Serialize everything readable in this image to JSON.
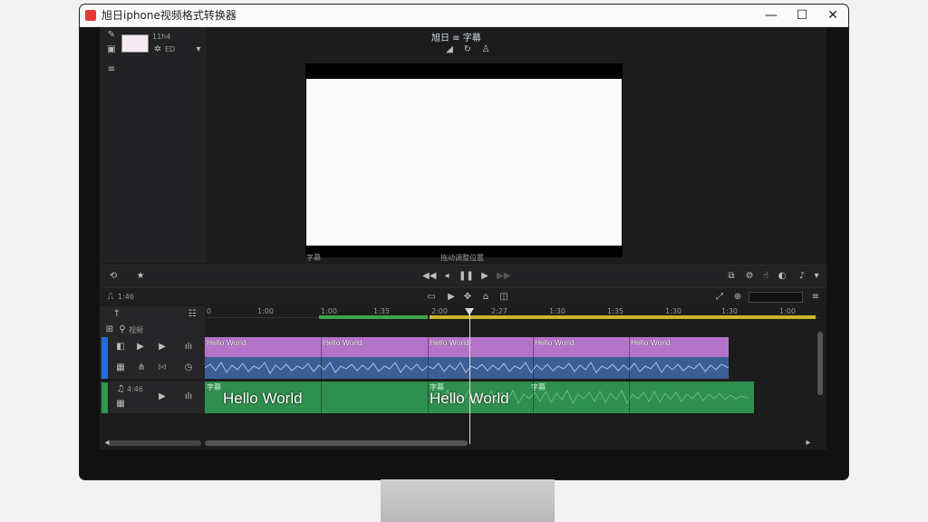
{
  "window": {
    "title": "旭日iphone视频格式转换器",
    "minimize": "—",
    "maximize": "☐",
    "close": "✕"
  },
  "top_panel": {
    "thumb_label": "11h4",
    "small_btn": "ED",
    "center_title": "旭日 ≡ 字幕",
    "under_video_left": "字幕",
    "under_video_center": "拖动调整位置"
  },
  "ruler": {
    "ticks": [
      "0",
      "1:00",
      "1:00",
      "1:35",
      "2:00",
      "2:27",
      "1:30",
      "1:35",
      "1:30",
      "1:30",
      "1:00"
    ]
  },
  "tracks": {
    "header_label": "视频",
    "audio_label": "4:46",
    "purple_labels": [
      "Hello World",
      "Hello World",
      "Hello World",
      "Hello World",
      "Hello World"
    ],
    "green_small_labels": [
      "字幕",
      "字幕",
      "字幕"
    ],
    "green_big_labels": [
      "Hello World",
      "Hello World"
    ]
  },
  "timeline_toolbar": {
    "left_label": "1:46"
  },
  "colors": {
    "purple_clip": "#b473c9",
    "audio_clip": "#3b5e95",
    "green_clip": "#2f8f4e",
    "accent_blue": "#1e6fd9"
  }
}
